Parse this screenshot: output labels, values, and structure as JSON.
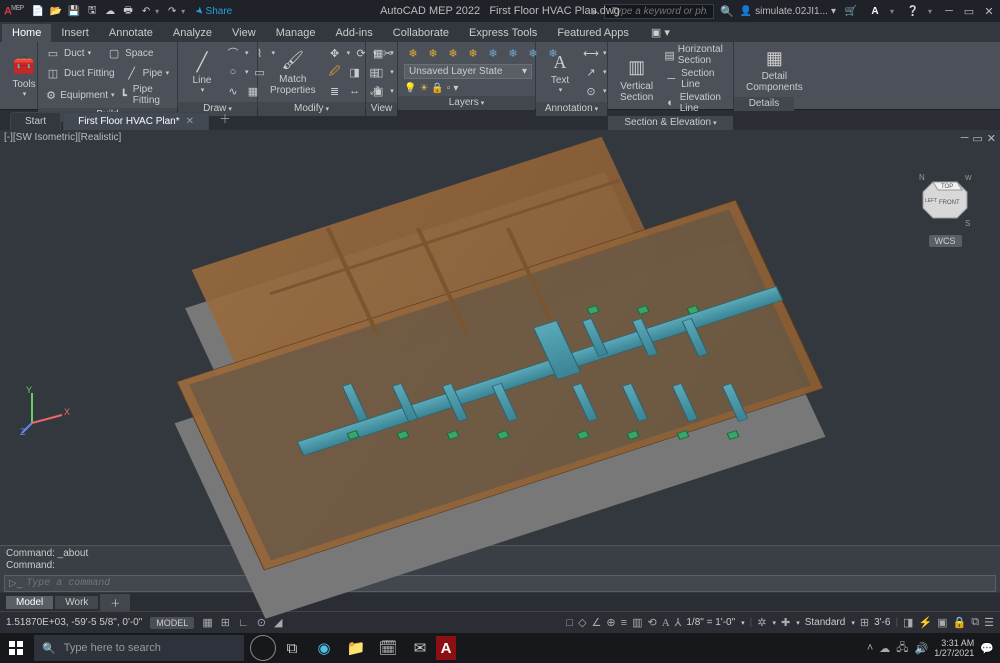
{
  "titlebar": {
    "logo": "A",
    "logo_sup": "MEP",
    "share": "Share",
    "app": "AutoCAD MEP 2022",
    "file": "First Floor HVAC Plan.dwg",
    "search_placeholder": "Type a keyword or phrase",
    "signin": "simulate.02JI1..."
  },
  "menu": {
    "tabs": [
      "Home",
      "Insert",
      "Annotate",
      "Analyze",
      "View",
      "Manage",
      "Add-ins",
      "Collaborate",
      "Express Tools",
      "Featured Apps"
    ]
  },
  "ribbon": {
    "tools": "Tools",
    "build": {
      "label": "Build",
      "duct": "Duct",
      "space": "Space",
      "ductfitting": "Duct Fitting",
      "pipe": "Pipe",
      "equipment": "Equipment",
      "pipefitting": "Pipe Fitting"
    },
    "draw": {
      "label": "Draw",
      "line": "Line"
    },
    "modify": {
      "label": "Modify",
      "match": "Match\nProperties"
    },
    "view": {
      "label": "View"
    },
    "layers": {
      "label": "Layers",
      "state": "Unsaved Layer State"
    },
    "annotation": {
      "label": "Annotation",
      "text": "Text"
    },
    "section": {
      "label": "Section & Elevation",
      "vsec": "Vertical\nSection",
      "hsec": "Horizontal Section",
      "sline": "Section Line",
      "eline": "Elevation Line"
    },
    "details": {
      "label": "Details",
      "comp": "Detail\nComponents"
    }
  },
  "doctabs": {
    "start": "Start",
    "file": "First Floor HVAC Plan*"
  },
  "viewport": {
    "label": "[-][SW Isometric][Realistic]",
    "wcs": "WCS"
  },
  "cmd": {
    "l1": "Command: _about",
    "l2": "Command:",
    "placeholder": "Type a command"
  },
  "docbar": {
    "model": "Model",
    "work": "Work"
  },
  "status": {
    "coords": "1.51870E+03, -59'-5 5/8\", 0'-0\"",
    "model": "MODEL",
    "scale": "1/8\" = 1'-0\"",
    "style": "Standard",
    "elev": "3'-6"
  },
  "taskbar": {
    "search": "Type here to search",
    "time": "3:31 AM",
    "date": "1/27/2021"
  }
}
